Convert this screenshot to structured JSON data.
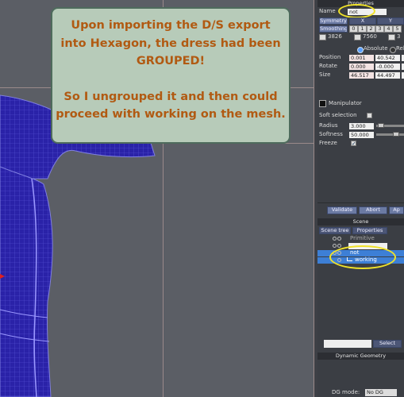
{
  "note": {
    "lines1": [
      "Upon importing the D/S export",
      "into Hexagon, the dress had been",
      "GROUPED!"
    ],
    "lines2": [
      "So I ungrouped it and then could",
      "proceed with working on the mesh."
    ]
  },
  "properties": {
    "header": "Properties",
    "name_label": "Name",
    "name_value": "not",
    "symmetry_label": "Symmetry",
    "sym_axes": [
      "X",
      "Y"
    ],
    "smoothing_label": "Smoothing",
    "smoothing_levels": [
      "0",
      "1",
      "2",
      "3",
      "4",
      "5"
    ],
    "counts": [
      "3826",
      "7560",
      "3"
    ],
    "absolute_label": "Absolute",
    "relative_label": "Rel",
    "position_label": "Position",
    "position_values": [
      "0.001",
      "40.542"
    ],
    "rotate_label": "Rotate",
    "rotate_values": [
      "0.000",
      "-0.000"
    ],
    "size_label": "Size",
    "size_values": [
      "46.517",
      "44.497"
    ],
    "manipulator_label": "Manipulator",
    "soft_selection_label": "Soft selection",
    "radius_label": "Radius",
    "radius_value": "3.000",
    "softness_label": "Softness",
    "softness_value": "50.000",
    "freeze_label": "Freeze",
    "buttons": {
      "validate": "Validate",
      "abort": "Abort",
      "apply": "Ap"
    }
  },
  "scene": {
    "header": "Scene",
    "tabs": [
      "Scene tree",
      "Properties"
    ],
    "items": [
      "Primitive",
      "",
      "not",
      "working"
    ]
  },
  "select_button": "Select",
  "dynamic_geometry": {
    "header": "Dynamic Geometry",
    "dg_mode_label": "DG mode:",
    "dg_mode_value": "No DG"
  },
  "colors": {
    "accent": "#f0e22a",
    "note_text": "#b15a12",
    "note_bg": "#b7cbb9",
    "mesh": "#2a22a8",
    "selection": "#3d7fd6"
  },
  "icons": [
    "expand-icon",
    "eye-icon",
    "lock-icon",
    "manipulator-icon",
    "radio-icon",
    "checkbox-icon"
  ]
}
